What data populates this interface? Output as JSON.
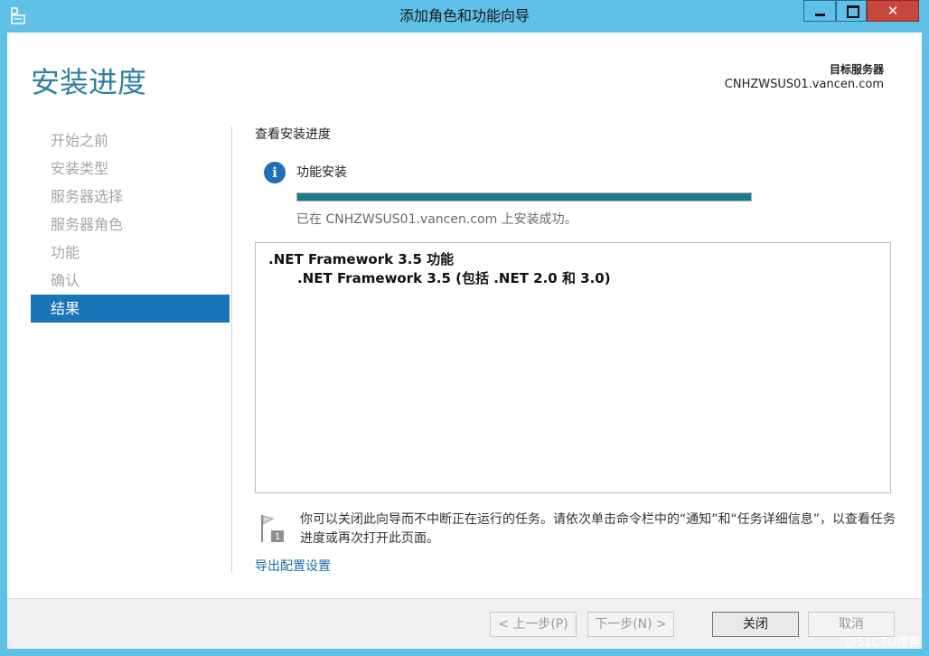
{
  "window": {
    "title": "添加角色和功能向导",
    "close_glyph": "✕"
  },
  "header": {
    "page_title": "安装进度",
    "destination_label": "目标服务器",
    "destination_value": "CNHZWSUS01.vancen.com"
  },
  "sidebar": {
    "items": [
      {
        "label": "开始之前",
        "active": false
      },
      {
        "label": "安装类型",
        "active": false
      },
      {
        "label": "服务器选择",
        "active": false
      },
      {
        "label": "服务器角色",
        "active": false
      },
      {
        "label": "功能",
        "active": false
      },
      {
        "label": "确认",
        "active": false
      },
      {
        "label": "结果",
        "active": true
      }
    ]
  },
  "main": {
    "section_title": "查看安装进度",
    "info_glyph": "i",
    "feature_install_label": "功能安装",
    "progress_fraction": 1.0,
    "status_text": "已在 CNHZWSUS01.vancen.com 上安装成功。",
    "results": {
      "line1": ".NET Framework 3.5 功能",
      "line2": ".NET Framework 3.5 (包括 .NET 2.0 和 3.0)"
    },
    "note_badge": "1",
    "note_text": "你可以关闭此向导而不中断正在运行的任务。请依次单击命令栏中的“通知”和“任务详细信息”，以查看任务进度或再次打开此页面。",
    "export_link": "导出配置设置"
  },
  "footer": {
    "prev_label": "< 上一步(P)",
    "next_label": "下一步(N) >",
    "close_label": "关闭",
    "cancel_label": "取消"
  },
  "watermark": "@51CTO博客",
  "colors": {
    "title_bar": "#5fc0e8",
    "accent": "#1a74b8",
    "progress": "#1c7a8c",
    "close_button": "#c7463e"
  }
}
